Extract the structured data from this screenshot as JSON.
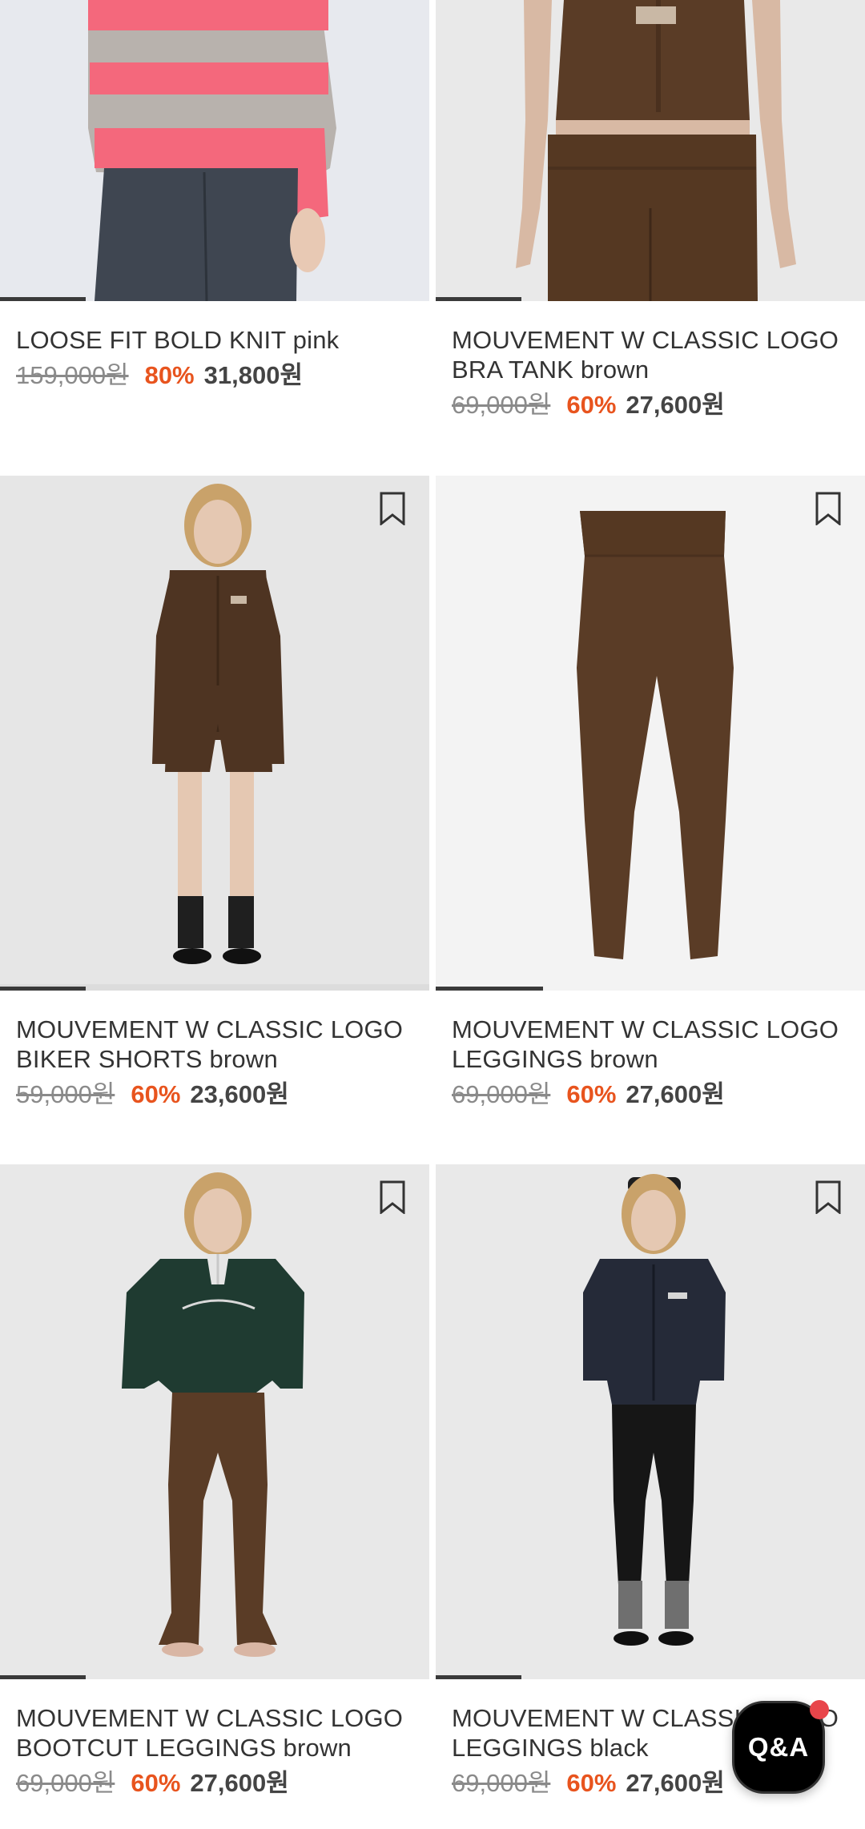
{
  "products": [
    {
      "name": "LOOSE FIT BOLD KNIT pink",
      "original_price": "159,000원",
      "discount": "80%",
      "sale_price": "31,800원",
      "image_bg": "#e7e9ee",
      "slide_progress": 0.2
    },
    {
      "name": "MOUVEMENT W CLASSIC LOGO BRA TANK brown",
      "original_price": "69,000원",
      "discount": "60%",
      "sale_price": "27,600원",
      "image_bg": "#e9e9e9",
      "slide_progress": 0.2
    },
    {
      "name": "MOUVEMENT W CLASSIC LOGO BIKER SHORTS brown",
      "original_price": "59,000원",
      "discount": "60%",
      "sale_price": "23,600원",
      "image_bg": "#e6e6e6",
      "slide_progress": 0.2
    },
    {
      "name": "MOUVEMENT W CLASSIC LOGO LEGGINGS brown",
      "original_price": "69,000원",
      "discount": "60%",
      "sale_price": "27,600원",
      "image_bg": "#f3f3f3",
      "slide_progress": 0.25
    },
    {
      "name": "MOUVEMENT W CLASSIC LOGO BOOTCUT LEGGINGS brown",
      "original_price": "69,000원",
      "discount": "60%",
      "sale_price": "27,600원",
      "image_bg": "#e8e8e8",
      "slide_progress": 0.2
    },
    {
      "name": "MOUVEMENT W CLASSIC LOGO LEGGINGS black",
      "original_price": "69,000원",
      "discount": "60%",
      "sale_price": "27,600원",
      "image_bg": "#e9e9e9",
      "slide_progress": 0.2
    }
  ],
  "qa_button": {
    "label": "Q&A",
    "has_notification": true
  },
  "colors": {
    "discount": "#e8541e",
    "price_text": "#444444",
    "strike_price": "#8a8a8a",
    "notification_dot": "#e8454a"
  },
  "icons": {
    "bookmark": "bookmark-icon"
  }
}
